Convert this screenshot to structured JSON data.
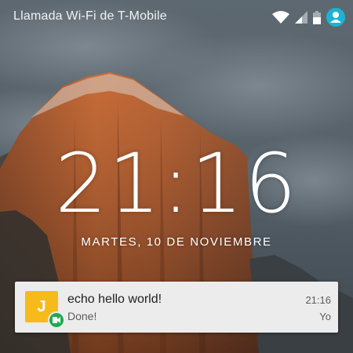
{
  "status_bar": {
    "carrier": "Llamada Wi-Fi de T-Mobile",
    "icons": [
      "wifi-icon",
      "cell-signal-icon",
      "battery-icon",
      "user-account-icon"
    ],
    "accent_color": "#1ab3d3"
  },
  "lock_screen": {
    "time": "21:16",
    "date": "MARTES, 10 DE NOVIEMBRE"
  },
  "notification": {
    "avatar_letter": "J",
    "avatar_color": "#f6bb1b",
    "badge_icon": "hangouts-icon",
    "badge_color": "#1faa4f",
    "title": "echo hello world!",
    "text": "Done!",
    "time": "21:16",
    "sender": "Yo"
  }
}
